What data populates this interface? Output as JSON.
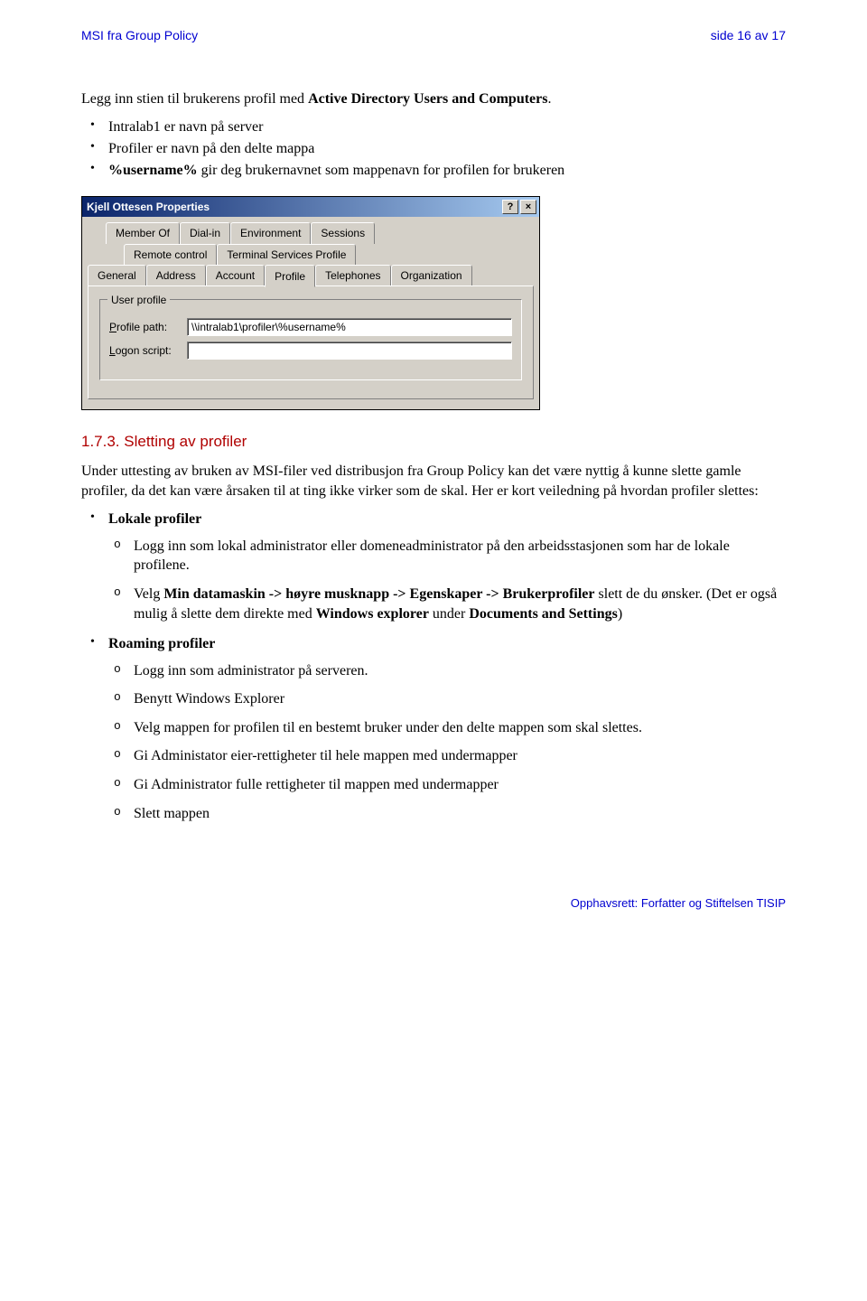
{
  "header": {
    "left": "MSI fra Group Policy",
    "right": "side 16 av 17"
  },
  "intro": {
    "line_pre": "Legg inn stien til brukerens profil med ",
    "line_bold": "Active Directory Users and Computers",
    "line_post": ".",
    "bullets": [
      "Intralab1 er navn på server",
      "Profiler er navn på den delte mappa"
    ],
    "b3_bold": "%username%",
    "b3_rest": "  gir deg brukernavnet som mappenavn for profilen for brukeren"
  },
  "dialog": {
    "title": "Kjell Ottesen Properties",
    "help_glyph": "?",
    "close_glyph": "×",
    "tabs_row1": [
      "Member Of",
      "Dial-in",
      "Environment",
      "Sessions"
    ],
    "tabs_row2": [
      "Remote control",
      "Terminal Services Profile"
    ],
    "tabs_row3": [
      "General",
      "Address",
      "Account",
      "Profile",
      "Telephones",
      "Organization"
    ],
    "group_legend": "User profile",
    "profile_label_pre": "P",
    "profile_label_post": "rofile path:",
    "profile_value": "\\\\intralab1\\profiler\\%username%",
    "logon_label_pre": "L",
    "logon_label_post": "ogon script:",
    "logon_value": ""
  },
  "section": {
    "heading": "1.7.3.   Sletting av profiler",
    "para": "Under uttesting av bruken av MSI-filer ved distribusjon fra Group Policy kan det være nyttig å kunne slette gamle profiler, da det kan være årsaken til at ting ikke virker som de skal. Her er kort veiledning på hvordan profiler slettes:",
    "lokale_title": "Lokale profiler",
    "lokale_1": "Logg inn som lokal administrator eller domeneadministrator på den arbeidsstasjonen som har de lokale profilene.",
    "lokale_2_pre": "Velg ",
    "lokale_2_bold": "Min datamaskin -> høyre musknapp -> Egenskaper -> Brukerprofiler",
    "lokale_2_mid": " slett de du ønsker. (Det er også mulig å slette dem direkte med ",
    "lokale_2_bold2": "Windows explorer",
    "lokale_2_post": " under ",
    "lokale_2_bold3": "Documents and Settings",
    "lokale_2_end": ")",
    "roaming_title": "Roaming profiler",
    "roaming_items": [
      "Logg inn som administrator på serveren.",
      "Benytt Windows Explorer",
      "Velg mappen for profilen til en bestemt bruker under den delte mappen som skal slettes.",
      "Gi Administator eier-rettigheter til hele mappen med undermapper",
      "Gi Administrator fulle rettigheter til mappen med undermapper",
      "Slett mappen"
    ]
  },
  "footer": "Opphavsrett:  Forfatter og Stiftelsen TISIP"
}
